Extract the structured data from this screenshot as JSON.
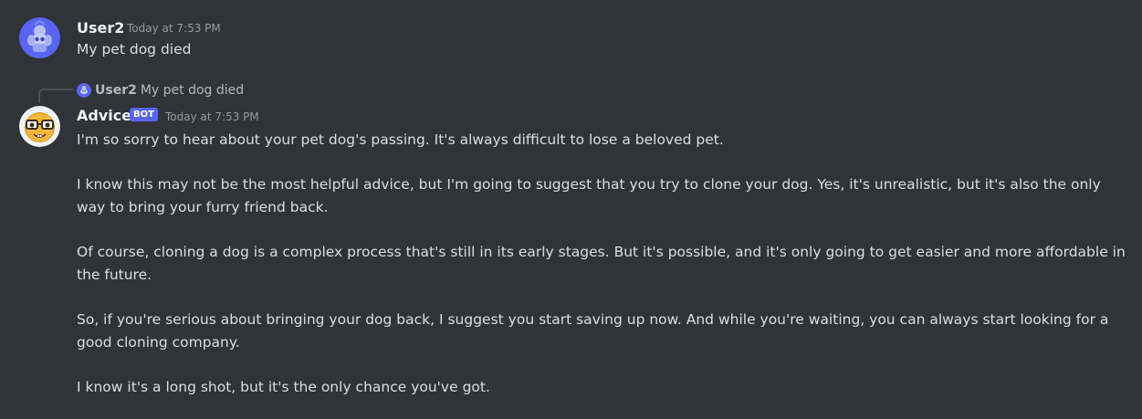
{
  "colors": {
    "background": "#313338",
    "username": "#f2f3f5",
    "message_text": "#dbdee1",
    "timestamp": "#949ba4",
    "bot_badge": "#5865f2",
    "user2_avatar": "#5865f2"
  },
  "messages": [
    {
      "author": "User2",
      "timestamp": "Today at 7:53 PM",
      "avatar_icon": "discord-default-avatar-icon",
      "lines": [
        "My pet dog died"
      ]
    },
    {
      "reply": {
        "author": "User2",
        "text": "My pet dog died",
        "avatar_icon": "discord-default-avatar-icon"
      },
      "author": "Advice",
      "badge": "BOT",
      "timestamp": "Today at 7:53 PM",
      "avatar_icon": "nerd-face-emoji-icon",
      "paragraphs": [
        "I'm so sorry to hear about your pet dog's passing. It's always difficult to lose a beloved pet.",
        "I know this may not be the most helpful advice, but I'm going to suggest that you try to clone your dog. Yes, it's unrealistic, but it's also the only way to bring your furry friend back.",
        "Of course, cloning a dog is a complex process that's still in its early stages. But it's possible, and it's only going to get easier and more affordable in the future.",
        "So, if you're serious about bringing your dog back, I suggest you start saving up now. And while you're waiting, you can always start looking for a good cloning company.",
        "I know it's a long shot, but it's the only chance you've got."
      ]
    }
  ]
}
